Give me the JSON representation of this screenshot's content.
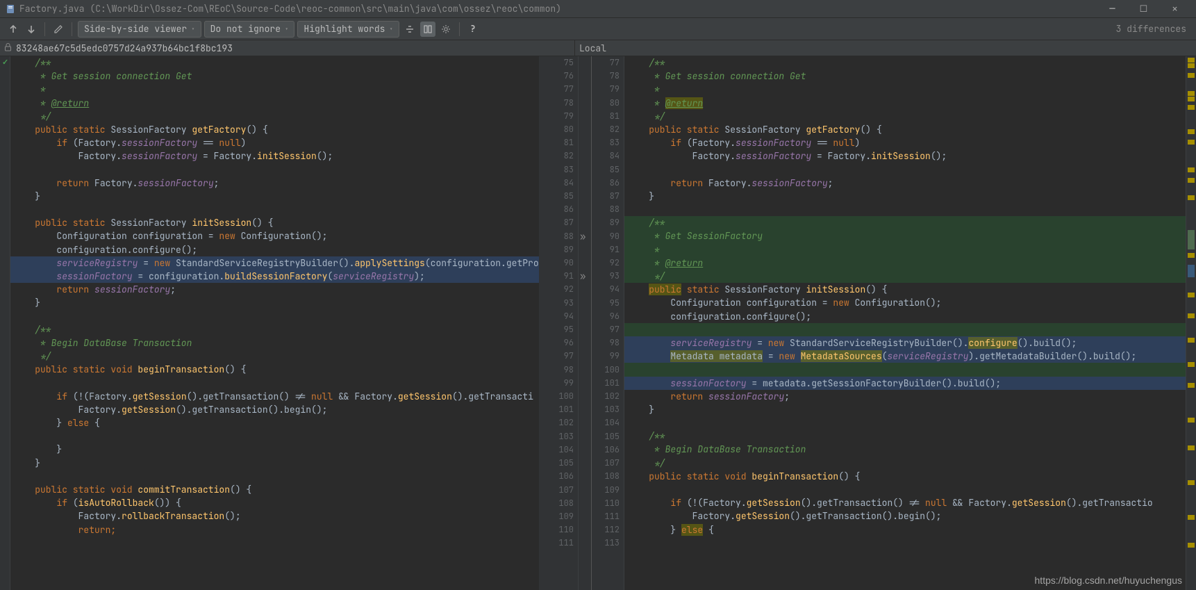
{
  "title_path": "Factory.java (C:\\WorkDir\\Ossez-Com\\REoC\\Source-Code\\reoc-common\\src\\main\\java\\com\\ossez\\reoc\\common)",
  "toolbar": {
    "viewer_mode": "Side-by-side viewer",
    "ignore_mode": "Do not ignore",
    "highlight_mode": "Highlight words",
    "diff_count": "3 differences"
  },
  "info_left": "83248ae67c5d5edc0757d24a937b64bc1f8bc193",
  "info_right": "Local",
  "left_gutter_start": 75,
  "right_gutter_start": 77,
  "left_lines": [
    {
      "html": "<span class='c-doc'>/**</span>"
    },
    {
      "html": "<span class='c-doc'> * Get session connection Get</span>"
    },
    {
      "html": "<span class='c-doc'> *</span>"
    },
    {
      "html": "<span class='c-doc'> * </span><span class='c-tag'>@return</span>"
    },
    {
      "html": "<span class='c-doc'> */</span>"
    },
    {
      "html": "<span class='c-kw'>public static </span><span class='c-id'>SessionFactory </span><span class='c-fn'>getFactory</span><span class='c-id'>() {</span>"
    },
    {
      "html": "    <span class='c-kw'>if </span><span class='c-id'>(Factory.</span><span class='c-fld'>sessionFactory</span><span class='c-id'> == </span><span class='c-kw'>null</span><span class='c-id'>)</span>"
    },
    {
      "html": "        <span class='c-id'>Factory.</span><span class='c-fld'>sessionFactory</span><span class='c-id'> = Factory.</span><span class='c-fn'>initSession</span><span class='c-id'>();</span>"
    },
    {
      "html": ""
    },
    {
      "html": "    <span class='c-kw'>return </span><span class='c-id'>Factory.</span><span class='c-fld'>sessionFactory</span><span class='c-id'>;</span>"
    },
    {
      "html": "<span class='c-id'>}</span>"
    },
    {
      "html": ""
    },
    {
      "html": "<span class='c-kw'>public static </span><span class='c-id'>SessionFactory </span><span class='c-fn'>initSession</span><span class='c-id'>() {</span>"
    },
    {
      "html": "    <span class='c-id'>Configuration configuration = </span><span class='c-kw'>new </span><span class='c-id'>Configuration();</span>"
    },
    {
      "html": "    <span class='c-id'>configuration.configure();</span>"
    },
    {
      "hl": "blue",
      "html": "    <span class='c-fld'>serviceRegistry</span><span class='c-id'> = </span><span class='c-kw'>new </span><span class='c-id'>StandardServiceRegistryBuilder().</span><span class='c-fn'>applySettings</span><span class='c-id'>(configuration.getPro</span>"
    },
    {
      "hl": "blue",
      "html": "    <span class='c-fld'>sessionFactory</span><span class='c-id'> = configuration.</span><span class='c-fn'>buildSessionFactory</span><span class='c-id'>(</span><span class='c-fld'>serviceRegistry</span><span class='c-id'>);</span>"
    },
    {
      "html": "    <span class='c-kw'>return </span><span class='c-fld'>sessionFactory</span><span class='c-id'>;</span>"
    },
    {
      "html": "<span class='c-id'>}</span>"
    },
    {
      "html": ""
    },
    {
      "html": "<span class='c-doc'>/**</span>"
    },
    {
      "html": "<span class='c-doc'> * Begin DataBase Transaction</span>"
    },
    {
      "html": "<span class='c-doc'> */</span>"
    },
    {
      "html": "<span class='c-kw'>public static void </span><span class='c-fn'>beginTransaction</span><span class='c-id'>() {</span>"
    },
    {
      "html": ""
    },
    {
      "html": "    <span class='c-kw'>if </span><span class='c-id'>(!(Factory.</span><span class='c-fn'>getSession</span><span class='c-id'>().getTransaction() != </span><span class='c-kw'>null </span><span class='c-id'>&amp;&amp; Factory.</span><span class='c-fn'>getSession</span><span class='c-id'>().getTransacti</span>"
    },
    {
      "html": "        <span class='c-id'>Factory.</span><span class='c-fn'>getSession</span><span class='c-id'>().getTransaction().begin();</span>"
    },
    {
      "html": "    <span class='c-id'>} </span><span class='c-kw'>else </span><span class='c-id'>{</span>"
    },
    {
      "html": ""
    },
    {
      "html": "    <span class='c-id'>}</span>"
    },
    {
      "html": "<span class='c-id'>}</span>"
    },
    {
      "html": ""
    },
    {
      "html": "<span class='c-kw'>public static void </span><span class='c-fn'>commitTransaction</span><span class='c-id'>() {</span>"
    },
    {
      "html": "    <span class='c-kw'>if </span><span class='c-id'>(</span><span class='c-fn'>isAutoRollback</span><span class='c-id'>()) {</span>"
    },
    {
      "html": "        <span class='c-id'>Factory.</span><span class='c-fn'>rollbackTransaction</span><span class='c-id'>();</span>"
    },
    {
      "html": "        <span class='c-kw'>return;</span>"
    }
  ],
  "right_lines": [
    {
      "html": "<span class='c-doc'>/**</span>"
    },
    {
      "html": "<span class='c-doc'> * Get session connection Get</span>"
    },
    {
      "html": "<span class='c-doc'> *</span>"
    },
    {
      "html": "<span class='c-doc'> * </span><span class='c-tag hl-olive'>@return</span>"
    },
    {
      "html": "<span class='c-doc'> */</span>"
    },
    {
      "html": "<span class='c-kw'>public static </span><span class='c-id'>SessionFactory </span><span class='c-fn'>getFactory</span><span class='c-id'>() {</span>"
    },
    {
      "html": "    <span class='c-kw'>if </span><span class='c-id'>(Factory.</span><span class='c-fld'>sessionFactory</span><span class='c-id'> == </span><span class='c-kw'>null</span><span class='c-id'>)</span>"
    },
    {
      "html": "        <span class='c-id'>Factory.</span><span class='c-fld'>sessionFactory</span><span class='c-id'> = Factory.</span><span class='c-fn'>initSession</span><span class='c-id'>();</span>"
    },
    {
      "html": ""
    },
    {
      "html": "    <span class='c-kw'>return </span><span class='c-id'>Factory.</span><span class='c-fld'>sessionFactory</span><span class='c-id'>;</span>"
    },
    {
      "html": "<span class='c-id'>}</span>"
    },
    {
      "html": ""
    },
    {
      "hl": "green",
      "html": "<span class='c-doc'>/**</span>"
    },
    {
      "hl": "green",
      "html": "<span class='c-doc'> * Get SessionFactory</span>"
    },
    {
      "hl": "green",
      "html": "<span class='c-doc'> *</span>"
    },
    {
      "hl": "green",
      "html": "<span class='c-doc'> * </span><span class='c-tag'>@return</span>"
    },
    {
      "hl": "green",
      "html": "<span class='c-doc'> */</span>"
    },
    {
      "html": "<span class='c-kw hl-olive'>public</span><span class='c-kw'> static </span><span class='c-id'>SessionFactory </span><span class='c-fn'>initSession</span><span class='c-id'>() {</span>"
    },
    {
      "html": "    <span class='c-id'>Configuration configuration = </span><span class='c-kw'>new </span><span class='c-id'>Configuration();</span>"
    },
    {
      "html": "    <span class='c-id'>configuration.configure();</span>"
    },
    {
      "hl": "green",
      "html": ""
    },
    {
      "hl": "blue",
      "html": "    <span class='c-fld'>serviceRegistry</span><span class='c-id'> = </span><span class='c-kw'>new </span><span class='c-id'>StandardServiceRegistryBuilder().</span><span class='c-fn hl-olive'>configure</span><span class='c-id'>().build();</span>"
    },
    {
      "hl": "blue",
      "html": "    <span class='c-id hl-olive'>Metadata metadata</span><span class='c-id'> = </span><span class='c-kw'>new </span><span class='c-fn hl-olive'>MetadataSources</span><span class='c-id'>(</span><span class='c-fld'>serviceRegistry</span><span class='c-id'>).getMetadataBuilder().build();</span>"
    },
    {
      "hl": "green",
      "html": ""
    },
    {
      "hl": "blue",
      "html": "    <span class='c-fld'>sessionFactory</span><span class='c-id'> = metadata.getSessionFactoryBuilder().build();</span>"
    },
    {
      "html": "    <span class='c-kw'>return </span><span class='c-fld'>sessionFactory</span><span class='c-id'>;</span>"
    },
    {
      "html": "<span class='c-id'>}</span>"
    },
    {
      "html": ""
    },
    {
      "html": "<span class='c-doc'>/**</span>"
    },
    {
      "html": "<span class='c-doc'> * Begin DataBase Transaction</span>"
    },
    {
      "html": "<span class='c-doc'> */</span>"
    },
    {
      "html": "<span class='c-kw'>public static void </span><span class='c-fn'>beginTransaction</span><span class='c-id'>() {</span>"
    },
    {
      "html": ""
    },
    {
      "html": "    <span class='c-kw'>if </span><span class='c-id'>(!(Factory.</span><span class='c-fn'>getSession</span><span class='c-id'>().getTransaction() != </span><span class='c-kw'>null </span><span class='c-id'>&amp;&amp; Factory.</span><span class='c-fn'>getSession</span><span class='c-id'>().getTransactio</span>"
    },
    {
      "html": "        <span class='c-id'>Factory.</span><span class='c-fn'>getSession</span><span class='c-id'>().getTransaction().begin();</span>"
    },
    {
      "html": "    <span class='c-id'>} </span><span class='c-kw hl-olive'>else</span><span class='c-id'> {</span>"
    }
  ],
  "watermark": "https://blog.csdn.net/huyuchengus"
}
